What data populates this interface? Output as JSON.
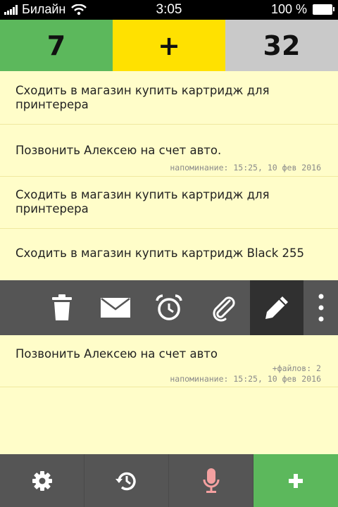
{
  "status_bar": {
    "carrier": "Билайн",
    "time": "3:05",
    "battery": "100 %"
  },
  "counters": {
    "left_value": "7",
    "middle_label": "+",
    "right_value": "32"
  },
  "tasks": [
    {
      "title": "Сходить в магазин купить картридж для принтерера"
    },
    {
      "title": "Позвонить Алексею на счет авто.",
      "reminder": "напоминание: 15:25, 10 фев 2016"
    },
    {
      "title": "Сходить в магазин купить картридж для принтерера"
    },
    {
      "title": "Сходить в магазин купить картридж Black 255"
    },
    {
      "title": "Позвонить Алексею на счет авто",
      "files": "+файлов: 2",
      "reminder": "напоминание: 15:25, 10 фев 2016"
    }
  ],
  "colors": {
    "background": "#fffdc9",
    "green": "#5cb85c",
    "yellow": "#ffe100",
    "gray": "#c9c9c9",
    "toolbar": "#555555",
    "mic": "#f4a0a0"
  },
  "icons": {
    "action_bar": [
      "trash-icon",
      "mail-icon",
      "alarm-clock-icon",
      "paperclip-icon",
      "pencil-icon",
      "more-vertical-icon"
    ],
    "bottom_bar": [
      "gear-icon",
      "history-icon",
      "microphone-icon",
      "plus-icon"
    ]
  }
}
